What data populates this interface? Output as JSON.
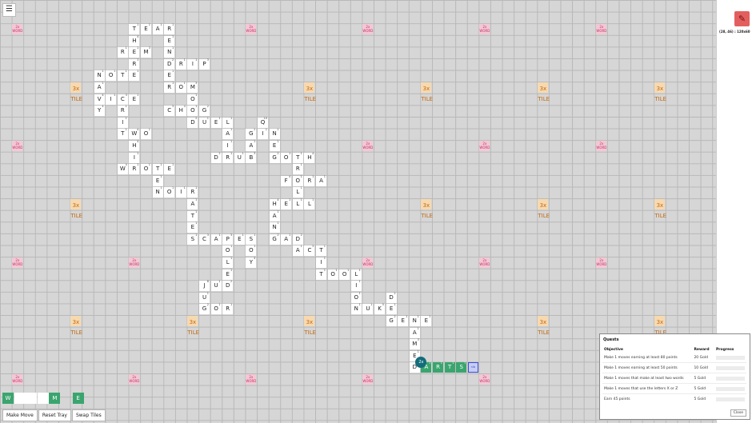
{
  "title_icon": "hamburger-menu-icon",
  "bonus_labels": {
    "word_line1": "2x",
    "word_line2": "WORD",
    "tile_line1": "3x",
    "tile_line2": "TILE"
  },
  "sidebar": {
    "coordinates": "(28, 46) : 120x60",
    "icon": "red-pencil-icon"
  },
  "board_tiles": [
    {
      "col": 11,
      "row": 2,
      "letter": "T",
      "points": 1
    },
    {
      "col": 12,
      "row": 2,
      "letter": "E",
      "points": 1
    },
    {
      "col": 13,
      "row": 2,
      "letter": "A",
      "points": 1
    },
    {
      "col": 14,
      "row": 2,
      "letter": "R",
      "points": 1
    },
    {
      "col": 11,
      "row": 3,
      "letter": "H",
      "points": 4
    },
    {
      "col": 14,
      "row": 3,
      "letter": "E",
      "points": 1
    },
    {
      "col": 10,
      "row": 4,
      "letter": "R",
      "points": 1
    },
    {
      "col": 11,
      "row": 4,
      "letter": "E",
      "points": 1
    },
    {
      "col": 12,
      "row": 4,
      "letter": "M",
      "points": 3
    },
    {
      "col": 14,
      "row": 4,
      "letter": "N",
      "points": 1
    },
    {
      "col": 11,
      "row": 5,
      "letter": "R",
      "points": 1
    },
    {
      "col": 14,
      "row": 5,
      "letter": "D",
      "points": 2
    },
    {
      "col": 15,
      "row": 5,
      "letter": "R",
      "points": 1
    },
    {
      "col": 16,
      "row": 5,
      "letter": "I",
      "points": 1
    },
    {
      "col": 17,
      "row": 5,
      "letter": "P",
      "points": 3
    },
    {
      "col": 8,
      "row": 6,
      "letter": "N",
      "points": 1
    },
    {
      "col": 9,
      "row": 6,
      "letter": "O",
      "points": 1
    },
    {
      "col": 10,
      "row": 6,
      "letter": "T",
      "points": 1
    },
    {
      "col": 11,
      "row": 6,
      "letter": "E",
      "points": 1
    },
    {
      "col": 14,
      "row": 6,
      "letter": "E",
      "points": 1
    },
    {
      "col": 8,
      "row": 7,
      "letter": "A",
      "points": 1
    },
    {
      "col": 14,
      "row": 7,
      "letter": "R",
      "points": 1
    },
    {
      "col": 15,
      "row": 7,
      "letter": "O",
      "points": 1
    },
    {
      "col": 16,
      "row": 7,
      "letter": "M",
      "points": 3
    },
    {
      "col": 8,
      "row": 8,
      "letter": "V",
      "points": 4
    },
    {
      "col": 9,
      "row": 8,
      "letter": "I",
      "points": 1
    },
    {
      "col": 10,
      "row": 8,
      "letter": "C",
      "points": 3
    },
    {
      "col": 11,
      "row": 8,
      "letter": "E",
      "points": 1
    },
    {
      "col": 16,
      "row": 8,
      "letter": "O",
      "points": 1
    },
    {
      "col": 8,
      "row": 9,
      "letter": "Y",
      "points": 4
    },
    {
      "col": 10,
      "row": 9,
      "letter": "R",
      "points": 1
    },
    {
      "col": 14,
      "row": 9,
      "letter": "C",
      "points": 3
    },
    {
      "col": 15,
      "row": 9,
      "letter": "H",
      "points": 4
    },
    {
      "col": 16,
      "row": 9,
      "letter": "O",
      "points": 1
    },
    {
      "col": 17,
      "row": 9,
      "letter": "G",
      "points": 2
    },
    {
      "col": 10,
      "row": 10,
      "letter": "I",
      "points": 1
    },
    {
      "col": 16,
      "row": 10,
      "letter": "D",
      "points": 2
    },
    {
      "col": 17,
      "row": 10,
      "letter": "U",
      "points": 1
    },
    {
      "col": 18,
      "row": 10,
      "letter": "E",
      "points": 1
    },
    {
      "col": 19,
      "row": 10,
      "letter": "L",
      "points": 1
    },
    {
      "col": 22,
      "row": 10,
      "letter": "Q",
      "points": 10
    },
    {
      "col": 10,
      "row": 11,
      "letter": "T",
      "points": 1
    },
    {
      "col": 11,
      "row": 11,
      "letter": "W",
      "points": 4
    },
    {
      "col": 12,
      "row": 11,
      "letter": "O",
      "points": 1
    },
    {
      "col": 19,
      "row": 11,
      "letter": "A",
      "points": 1
    },
    {
      "col": 21,
      "row": 11,
      "letter": "G",
      "points": 2
    },
    {
      "col": 22,
      "row": 11,
      "letter": "I",
      "points": 1
    },
    {
      "col": 23,
      "row": 11,
      "letter": "N",
      "points": 1
    },
    {
      "col": 11,
      "row": 12,
      "letter": "H",
      "points": 4
    },
    {
      "col": 19,
      "row": 12,
      "letter": "I",
      "points": 1
    },
    {
      "col": 21,
      "row": 12,
      "letter": "A",
      "points": 1
    },
    {
      "col": 23,
      "row": 12,
      "letter": "E",
      "points": 1
    },
    {
      "col": 11,
      "row": 13,
      "letter": "I",
      "points": 1
    },
    {
      "col": 18,
      "row": 13,
      "letter": "D",
      "points": 2
    },
    {
      "col": 19,
      "row": 13,
      "letter": "R",
      "points": 1
    },
    {
      "col": 20,
      "row": 13,
      "letter": "U",
      "points": 1
    },
    {
      "col": 21,
      "row": 13,
      "letter": "B",
      "points": 3
    },
    {
      "col": 23,
      "row": 13,
      "letter": "G",
      "points": 2
    },
    {
      "col": 24,
      "row": 13,
      "letter": "O",
      "points": 1
    },
    {
      "col": 25,
      "row": 13,
      "letter": "T",
      "points": 1
    },
    {
      "col": 26,
      "row": 13,
      "letter": "H",
      "points": 4
    },
    {
      "col": 10,
      "row": 14,
      "letter": "W",
      "points": 4
    },
    {
      "col": 11,
      "row": 14,
      "letter": "R",
      "points": 1
    },
    {
      "col": 12,
      "row": 14,
      "letter": "O",
      "points": 1
    },
    {
      "col": 13,
      "row": 14,
      "letter": "T",
      "points": 1
    },
    {
      "col": 14,
      "row": 14,
      "letter": "E",
      "points": 1
    },
    {
      "col": 25,
      "row": 14,
      "letter": "R",
      "points": 1
    },
    {
      "col": 13,
      "row": 15,
      "letter": "E",
      "points": 1
    },
    {
      "col": 24,
      "row": 15,
      "letter": "F",
      "points": 4
    },
    {
      "col": 25,
      "row": 15,
      "letter": "O",
      "points": 1
    },
    {
      "col": 26,
      "row": 15,
      "letter": "R",
      "points": 1
    },
    {
      "col": 27,
      "row": 15,
      "letter": "A",
      "points": 1
    },
    {
      "col": 13,
      "row": 16,
      "letter": "N",
      "points": 1
    },
    {
      "col": 14,
      "row": 16,
      "letter": "O",
      "points": 1
    },
    {
      "col": 15,
      "row": 16,
      "letter": "I",
      "points": 1
    },
    {
      "col": 16,
      "row": 16,
      "letter": "R",
      "points": 1
    },
    {
      "col": 25,
      "row": 16,
      "letter": "L",
      "points": 1
    },
    {
      "col": 16,
      "row": 17,
      "letter": "A",
      "points": 1
    },
    {
      "col": 23,
      "row": 17,
      "letter": "H",
      "points": 4
    },
    {
      "col": 24,
      "row": 17,
      "letter": "E",
      "points": 1
    },
    {
      "col": 25,
      "row": 17,
      "letter": "L",
      "points": 1
    },
    {
      "col": 26,
      "row": 17,
      "letter": "L",
      "points": 1
    },
    {
      "col": 16,
      "row": 18,
      "letter": "T",
      "points": 1
    },
    {
      "col": 23,
      "row": 18,
      "letter": "A",
      "points": 1
    },
    {
      "col": 16,
      "row": 19,
      "letter": "E",
      "points": 1
    },
    {
      "col": 23,
      "row": 19,
      "letter": "N",
      "points": 1
    },
    {
      "col": 16,
      "row": 20,
      "letter": "S",
      "points": 1
    },
    {
      "col": 17,
      "row": 20,
      "letter": "C",
      "points": 3
    },
    {
      "col": 18,
      "row": 20,
      "letter": "A",
      "points": 1
    },
    {
      "col": 19,
      "row": 20,
      "letter": "P",
      "points": 3
    },
    {
      "col": 20,
      "row": 20,
      "letter": "E",
      "points": 1
    },
    {
      "col": 21,
      "row": 20,
      "letter": "S",
      "points": 1
    },
    {
      "col": 23,
      "row": 20,
      "letter": "G",
      "points": 2
    },
    {
      "col": 24,
      "row": 20,
      "letter": "A",
      "points": 1
    },
    {
      "col": 25,
      "row": 20,
      "letter": "D",
      "points": 2
    },
    {
      "col": 19,
      "row": 21,
      "letter": "O",
      "points": 1
    },
    {
      "col": 21,
      "row": 21,
      "letter": "O",
      "points": 1
    },
    {
      "col": 25,
      "row": 21,
      "letter": "A",
      "points": 1
    },
    {
      "col": 26,
      "row": 21,
      "letter": "C",
      "points": 3
    },
    {
      "col": 27,
      "row": 21,
      "letter": "T",
      "points": 1
    },
    {
      "col": 19,
      "row": 22,
      "letter": "L",
      "points": 1
    },
    {
      "col": 21,
      "row": 22,
      "letter": "Y",
      "points": 4
    },
    {
      "col": 27,
      "row": 22,
      "letter": "I",
      "points": 1
    },
    {
      "col": 19,
      "row": 23,
      "letter": "E",
      "points": 1
    },
    {
      "col": 27,
      "row": 23,
      "letter": "T",
      "points": 1
    },
    {
      "col": 28,
      "row": 23,
      "letter": "O",
      "points": 1
    },
    {
      "col": 29,
      "row": 23,
      "letter": "O",
      "points": 1
    },
    {
      "col": 30,
      "row": 23,
      "letter": "L",
      "points": 1
    },
    {
      "col": 17,
      "row": 24,
      "letter": "J",
      "points": 8
    },
    {
      "col": 18,
      "row": 24,
      "letter": "U",
      "points": 1
    },
    {
      "col": 19,
      "row": 24,
      "letter": "D",
      "points": 2
    },
    {
      "col": 30,
      "row": 24,
      "letter": "I",
      "points": 1
    },
    {
      "col": 17,
      "row": 25,
      "letter": "U",
      "points": 1
    },
    {
      "col": 30,
      "row": 25,
      "letter": "O",
      "points": 1
    },
    {
      "col": 33,
      "row": 25,
      "letter": "D",
      "points": 2
    },
    {
      "col": 17,
      "row": 26,
      "letter": "G",
      "points": 2
    },
    {
      "col": 18,
      "row": 26,
      "letter": "O",
      "points": 1
    },
    {
      "col": 19,
      "row": 26,
      "letter": "R",
      "points": 1
    },
    {
      "col": 30,
      "row": 26,
      "letter": "N",
      "points": 1
    },
    {
      "col": 31,
      "row": 26,
      "letter": "U",
      "points": 1
    },
    {
      "col": 32,
      "row": 26,
      "letter": "K",
      "points": 5
    },
    {
      "col": 33,
      "row": 26,
      "letter": "E",
      "points": 1
    },
    {
      "col": 33,
      "row": 27,
      "letter": "G",
      "points": 2
    },
    {
      "col": 34,
      "row": 27,
      "letter": "E",
      "points": 1
    },
    {
      "col": 35,
      "row": 27,
      "letter": "N",
      "points": 1
    },
    {
      "col": 36,
      "row": 27,
      "letter": "E",
      "points": 1
    },
    {
      "col": 35,
      "row": 28,
      "letter": "A",
      "points": 1
    },
    {
      "col": 35,
      "row": 29,
      "letter": "M",
      "points": 3
    },
    {
      "col": 35,
      "row": 30,
      "letter": "E",
      "points": 1
    },
    {
      "col": 35,
      "row": 31,
      "letter": "D",
      "points": 2
    }
  ],
  "pending_tiles": [
    {
      "col": 36,
      "row": 31,
      "letter": "A",
      "points": 1
    },
    {
      "col": 37,
      "row": 31,
      "letter": "R",
      "points": 1
    },
    {
      "col": 38,
      "row": 31,
      "letter": "T",
      "points": 1
    },
    {
      "col": 39,
      "row": 31,
      "letter": "S",
      "points": 1
    }
  ],
  "ghost_cell": {
    "col": 40,
    "row": 31,
    "label": "nib"
  },
  "multiplier_badge": {
    "col": 36,
    "row": 31,
    "label": "2x"
  },
  "tray": {
    "tiles": [
      {
        "slot": 0,
        "letter": "W"
      },
      {
        "slot": 4,
        "letter": "M"
      },
      {
        "slot": 6,
        "letter": "E"
      }
    ],
    "empty_slots": [
      1,
      2,
      3
    ]
  },
  "buttons": {
    "make_move": "Make Move",
    "reset_tray": "Reset Tray",
    "swap_tiles": "Swap Tiles"
  },
  "quests": {
    "title": "Quests",
    "headers": {
      "objective": "Objective",
      "reward": "Reward",
      "progress": "Progress"
    },
    "rows": [
      {
        "objective": "Make 1 moves earning at least 80 points",
        "reward": "20 Gold",
        "progress": 0
      },
      {
        "objective": "Make 1 moves earning at least 50 points",
        "reward": "10 Gold",
        "progress": 0
      },
      {
        "objective": "Make 1 moves that make at least two words",
        "reward": "5 Gold",
        "progress": 0
      },
      {
        "objective": "Make 1 moves that use the letters X or Z",
        "reward": "5 Gold",
        "progress": 0
      },
      {
        "objective": "Earn 45 points",
        "reward": "5 Gold",
        "progress": 0
      }
    ],
    "close_label": "Close"
  }
}
